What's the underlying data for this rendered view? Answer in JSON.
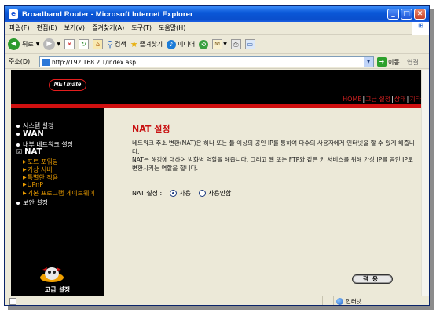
{
  "window": {
    "title": "Broadband Router - Microsoft Internet Explorer",
    "min_icon": "_",
    "max_icon": "□",
    "close_icon": "✕"
  },
  "menu": [
    "파일(F)",
    "편집(E)",
    "보기(V)",
    "즐겨찾기(A)",
    "도구(T)",
    "도움말(H)"
  ],
  "toolbar": {
    "back": "뒤로",
    "search": "검색",
    "favorites": "즐겨찾기",
    "media": "미디어"
  },
  "address": {
    "label": "주소(D)",
    "url": "http://192.168.2.1/index.asp",
    "go": "이동",
    "links": "연결"
  },
  "router": {
    "logo": "NETmate",
    "nav": {
      "home": "HOME",
      "advanced": "고급 설정",
      "status": "상태",
      "other": "기타"
    },
    "sidebar": {
      "items": [
        {
          "label": "시스템 설정"
        },
        {
          "label": "WAN"
        },
        {
          "label": "내부 네트워크 설정"
        },
        {
          "label": "NAT"
        },
        {
          "label": "보안 설정"
        }
      ],
      "nat_sub": [
        "포트 포워딩",
        "가상 서버",
        "특별한 적용",
        "UPnP",
        "기본 프로그램 게이트웨이"
      ],
      "advanced_label": "고급 설정"
    },
    "content": {
      "title": "NAT 설정",
      "description_1": "네트워크 주소 변환(NAT)은 하나 또는 둘 이상의 공인 IP를 통하여 다수의 사용자에게 인터넷을 할 수 있게 해줍니다.",
      "description_2": "NAT는 해킹에 대하여 방화벽 역할을 해줍니다. 그리고 웹 또는 FTP와 같은 키 서비스를 위해 가상 IP를 공인 IP로 변환시키는 역할을 합니다.",
      "setting_label": "NAT 설정 :",
      "option_enable": "사용",
      "option_disable": "사용안함",
      "selected": "사용",
      "apply": "적용"
    }
  },
  "status": {
    "zone": "인터넷"
  }
}
